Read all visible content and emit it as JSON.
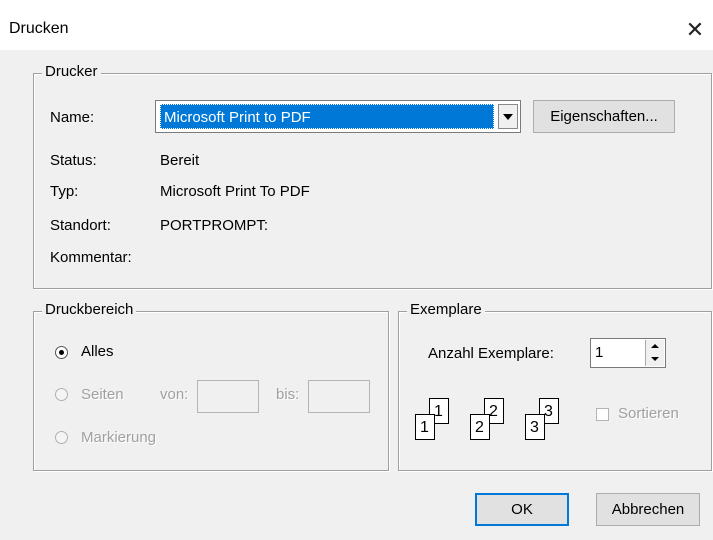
{
  "window": {
    "title": "Drucken"
  },
  "printer": {
    "group_label": "Drucker",
    "name_label": "Name:",
    "name_value": "Microsoft Print to PDF",
    "properties_button": "Eigenschaften...",
    "status_label": "Status:",
    "status_value": "Bereit",
    "type_label": "Typ:",
    "type_value": "Microsoft Print To PDF",
    "location_label": "Standort:",
    "location_value": "PORTPROMPT:",
    "comment_label": "Kommentar:"
  },
  "print_range": {
    "group_label": "Druckbereich",
    "options": [
      {
        "label": "Alles",
        "selected": true,
        "enabled": true
      },
      {
        "label": "Seiten",
        "selected": false,
        "enabled": false
      },
      {
        "label": "Markierung",
        "selected": false,
        "enabled": false
      }
    ],
    "from_label": "von:",
    "to_label": "bis:"
  },
  "copies": {
    "group_label": "Exemplare",
    "count_label": "Anzahl Exemplare:",
    "count_value": "1",
    "collate_label": "Sortieren",
    "collate_checked": false,
    "collate_enabled": false,
    "collate_icons": [
      {
        "back": "1",
        "front": "1"
      },
      {
        "back": "2",
        "front": "2"
      },
      {
        "back": "3",
        "front": "3"
      }
    ]
  },
  "buttons": {
    "ok": "OK",
    "cancel": "Abbrechen"
  },
  "colors": {
    "selection": "#0078d7",
    "face": "#f0f0f0"
  }
}
